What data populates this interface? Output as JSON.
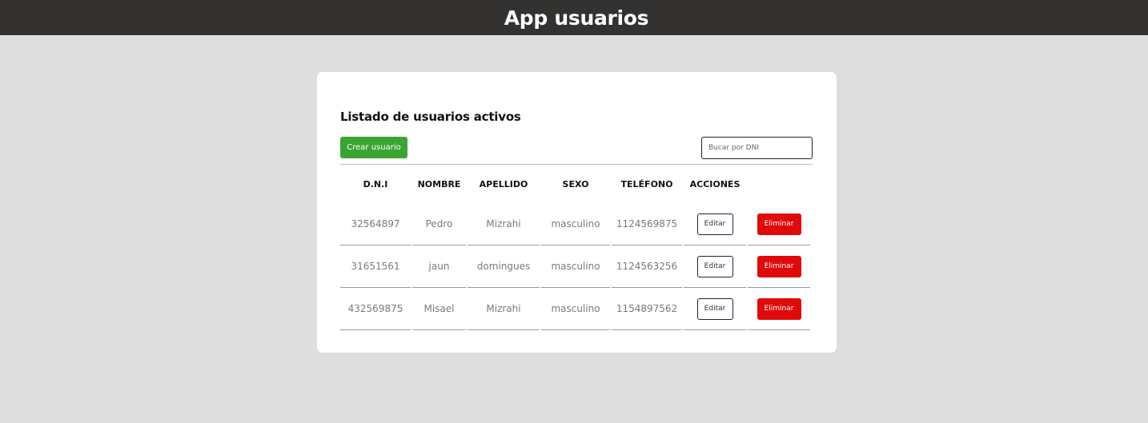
{
  "header": {
    "title": "App usuarios"
  },
  "card": {
    "title": "Listado de usuarios activos",
    "create_button": "Crear usuario",
    "search_placeholder": "Bucar por DNI"
  },
  "table": {
    "headers": [
      "D.N.I",
      "NOMBRE",
      "APELLIDO",
      "SEXO",
      "TELÉFONO",
      "ACCIONES"
    ],
    "rows": [
      {
        "dni": "32564897",
        "nombre": "Pedro",
        "apellido": "Mizrahi",
        "sexo": "masculino",
        "telefono": "1124569875",
        "edit_label": "Editar",
        "delete_label": "Eliminar"
      },
      {
        "dni": "31651561",
        "nombre": "jaun",
        "apellido": "domingues",
        "sexo": "masculino",
        "telefono": "1124563256",
        "edit_label": "Editar",
        "delete_label": "Eliminar"
      },
      {
        "dni": "432569875",
        "nombre": "Misael",
        "apellido": "Mizrahi",
        "sexo": "masculino",
        "telefono": "1154897562",
        "edit_label": "Editar",
        "delete_label": "Eliminar"
      }
    ]
  },
  "colors": {
    "topbar": "#343230",
    "background": "#dfdede",
    "create_button": "#3ba532",
    "delete_button": "#e10a0a",
    "edit_border": "#1f2440"
  }
}
